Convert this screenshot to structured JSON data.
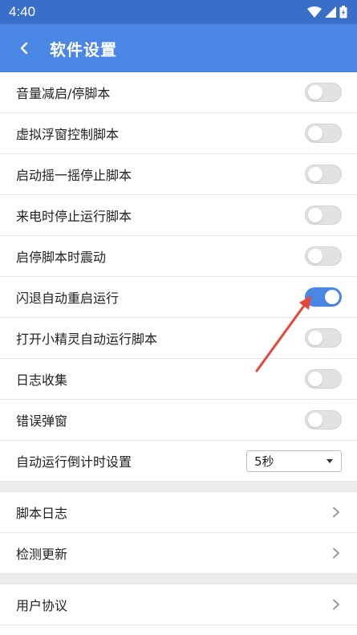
{
  "status_bar": {
    "time": "4:40"
  },
  "header": {
    "title": "软件设置"
  },
  "toggle_rows": [
    {
      "label": "音量减启/停脚本",
      "on": false
    },
    {
      "label": "虚拟浮窗控制脚本",
      "on": false
    },
    {
      "label": "启动摇一摇停止脚本",
      "on": false
    },
    {
      "label": "来电时停止运行脚本",
      "on": false
    },
    {
      "label": "启停脚本时震动",
      "on": false
    },
    {
      "label": "闪退自动重启运行",
      "on": true
    },
    {
      "label": "打开小精灵自动运行脚本",
      "on": false
    },
    {
      "label": "日志收集",
      "on": false
    },
    {
      "label": "错误弹窗",
      "on": false
    }
  ],
  "countdown": {
    "label": "自动运行倒计时设置",
    "value": "5秒"
  },
  "nav_group_1": [
    {
      "label": "脚本日志"
    },
    {
      "label": "检测更新"
    }
  ],
  "nav_group_2": [
    {
      "label": "用户协议"
    }
  ],
  "colors": {
    "accent": "#4a87e5",
    "status_bar": "#3a6fc9",
    "annotation_arrow": "#e8463a"
  }
}
